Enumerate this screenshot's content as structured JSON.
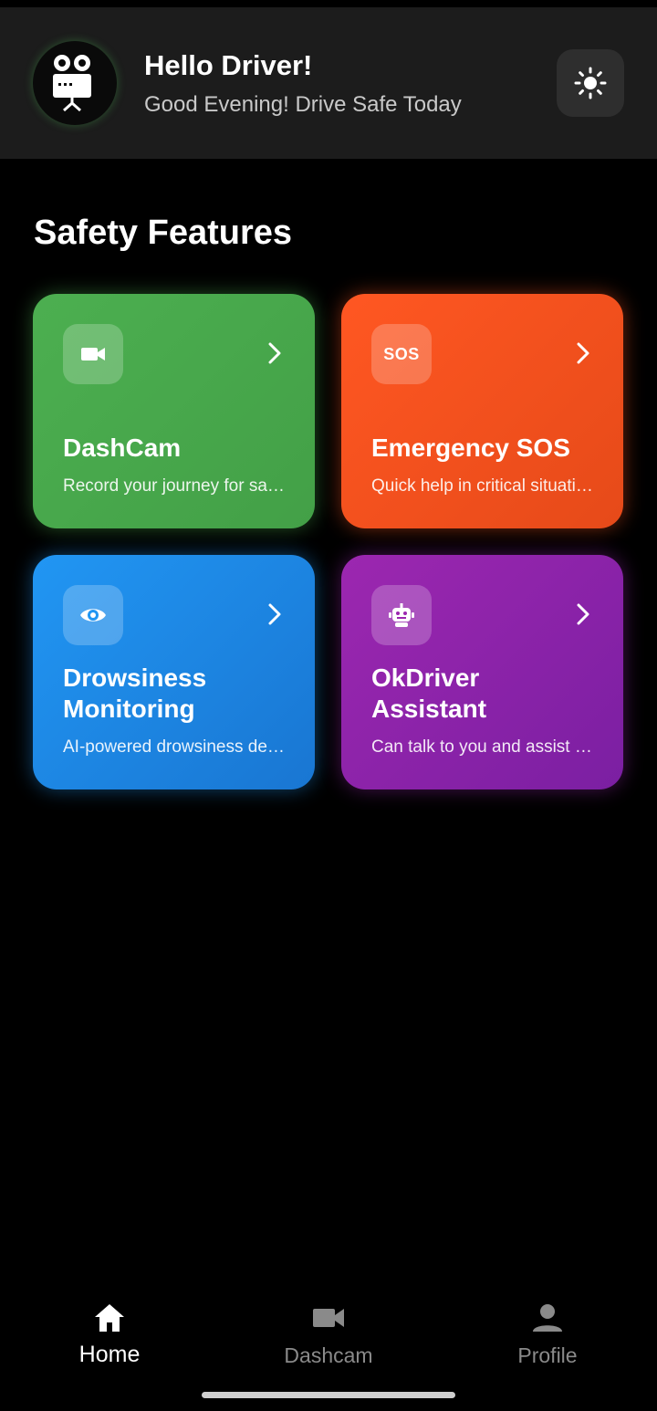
{
  "header": {
    "greeting": "Hello Driver!",
    "subtitle": "Good Evening! Drive Safe Today",
    "avatar_icon": "projector-robot-icon",
    "theme_toggle_icon": "sun-icon"
  },
  "section_title": "Safety Features",
  "features": [
    {
      "title": "DashCam",
      "description": "Record your journey for safety and evidence",
      "icon": "videocam-icon",
      "color": "#4caf50"
    },
    {
      "title": "Emergency SOS",
      "description": "Quick help in critical situations",
      "icon": "sos-icon",
      "icon_text": "SOS",
      "color": "#ff5722"
    },
    {
      "title": "Drowsiness Monitoring",
      "title_line1": "Drowsiness",
      "title_line2": "Monitoring",
      "description": "AI-powered drowsiness detection",
      "icon": "eye-icon",
      "color": "#2196f3"
    },
    {
      "title": "OkDriver Assistant",
      "title_line1": "OkDriver",
      "title_line2": "Assistant",
      "description": "Can talk to you and assist you",
      "icon": "robot-icon",
      "color": "#9c27b0"
    }
  ],
  "bottom_nav": {
    "items": [
      {
        "label": "Home",
        "icon": "home-icon",
        "active": true
      },
      {
        "label": "Dashcam",
        "icon": "videocam-icon",
        "active": false
      },
      {
        "label": "Profile",
        "icon": "person-icon",
        "active": false
      }
    ]
  }
}
